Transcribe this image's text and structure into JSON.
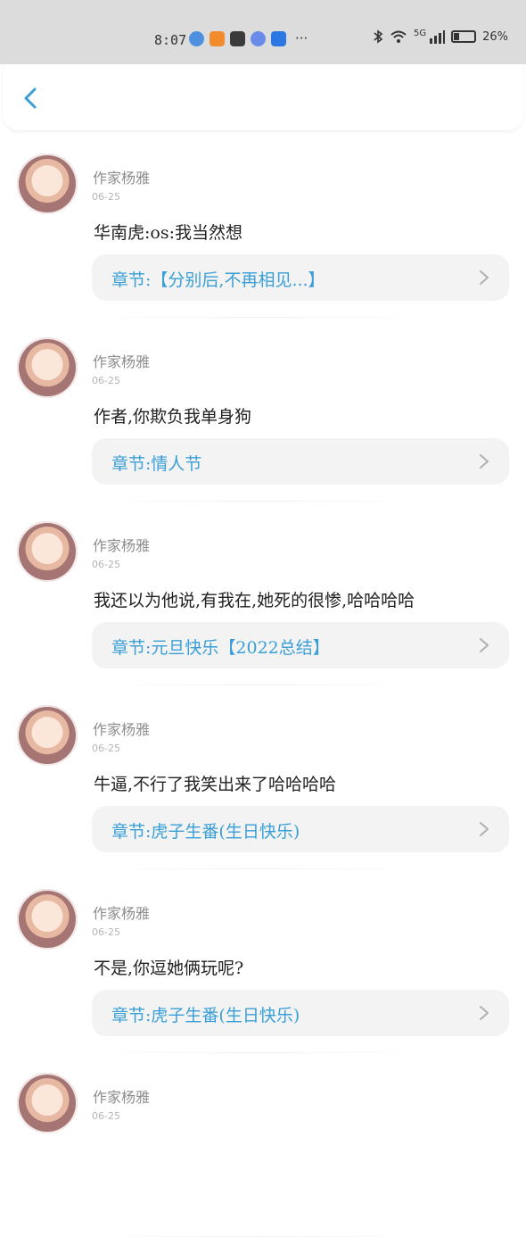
{
  "status_bar": {
    "time": "8:07",
    "more": "···",
    "network": "5G",
    "battery": "26%",
    "battery_level": 0.26,
    "icons": [
      "browser-app-icon",
      "video-app-icon",
      "heart-app-icon",
      "music-app-icon",
      "bulb-app-icon"
    ]
  },
  "header": {
    "back_icon": "chevron-left-icon",
    "accent": "#3a9fd6"
  },
  "comments": [
    {
      "author": "作家杨雅",
      "date": "06-25",
      "text": "华南虎:os:我当然想",
      "chapter": "章节:【分别后,不再相见...】"
    },
    {
      "author": "作家杨雅",
      "date": "06-25",
      "text": "作者,你欺负我单身狗",
      "chapter": "章节:情人节"
    },
    {
      "author": "作家杨雅",
      "date": "06-25",
      "text": "我还以为他说,有我在,她死的很惨,哈哈哈哈",
      "chapter": "章节:元旦快乐【2022总结】"
    },
    {
      "author": "作家杨雅",
      "date": "06-25",
      "text": "牛逼,不行了我笑出来了哈哈哈哈",
      "chapter": "章节:虎子生番(生日快乐)"
    },
    {
      "author": "作家杨雅",
      "date": "06-25",
      "text": "不是,你逗她俩玩呢?",
      "chapter": "章节:虎子生番(生日快乐)"
    },
    {
      "author": "作家杨雅",
      "date": "06-25",
      "text": "",
      "chapter": ""
    }
  ]
}
